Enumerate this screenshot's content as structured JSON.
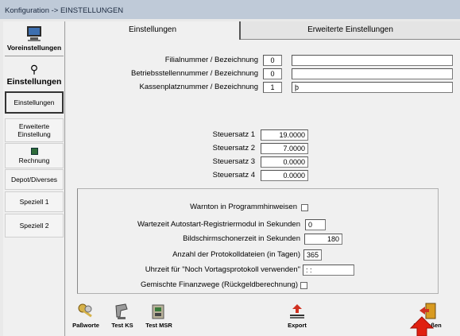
{
  "window": {
    "title": "Konfiguration -> EINSTELLUNGEN"
  },
  "sidebar": {
    "section1": {
      "label": "Voreinstellungen",
      "icon": "monitor-icon"
    },
    "section2": {
      "label": "Einstellungen",
      "icon": "wrench-icon"
    },
    "items": [
      {
        "label": "Einstellungen",
        "active": true
      },
      {
        "label": "Erweiterte Einstellung",
        "active": false
      },
      {
        "label": "Rechnung",
        "icon": "invoice-icon",
        "active": false
      },
      {
        "label": "Depot/Diverses",
        "active": false
      },
      {
        "label": "Speziell 1",
        "active": false
      },
      {
        "label": "Speziell 2",
        "active": false
      }
    ]
  },
  "tabs": [
    {
      "label": "Einstellungen",
      "active": true
    },
    {
      "label": "Erweiterte Einstellungen",
      "active": false
    }
  ],
  "ids": {
    "filial": {
      "label": "Filialnummer / Bezeichnung",
      "number": "0",
      "name": ""
    },
    "betrieb": {
      "label": "Betriebsstellennummer / Bezeichnung",
      "number": "0",
      "name": ""
    },
    "kasse": {
      "label": "Kassenplatznummer / Bezeichnung",
      "number": "1",
      "name": "þ"
    }
  },
  "steuer": [
    {
      "label": "Steuersatz 1",
      "value": "19.0000"
    },
    {
      "label": "Steuersatz 2",
      "value": "7.0000"
    },
    {
      "label": "Steuersatz 3",
      "value": "0.0000"
    },
    {
      "label": "Steuersatz 4",
      "value": "0.0000"
    }
  ],
  "options": {
    "warnton": {
      "label": "Warnton in Programmhinweisen",
      "checked": false
    },
    "wartezeit": {
      "label": "Wartezeit Autostart-Registriermodul in Sekunden",
      "value": "0"
    },
    "bildschirm": {
      "label": "Bildschirmschonerzeit in Sekunden",
      "value": "180"
    },
    "protokoll": {
      "label": "Anzahl der Protokolldateien (in Tagen)",
      "value": "365"
    },
    "uhrzeit": {
      "label": "Uhrzeit für \"Noch Vortagsprotokoll verwenden\"",
      "value": ": :"
    },
    "finanz": {
      "label": "Gemischte Finanzwege (Rückgeldberechnung)",
      "checked": false
    }
  },
  "toolbar": {
    "passworte": "Paßworte",
    "test_ks": "Test KS",
    "test_msr": "Test MSR",
    "export": "Export",
    "schliessen": "Schließen"
  },
  "colors": {
    "arrow": "#e02010",
    "titlebar": "#bfcad8",
    "exit": "#d89a20"
  }
}
